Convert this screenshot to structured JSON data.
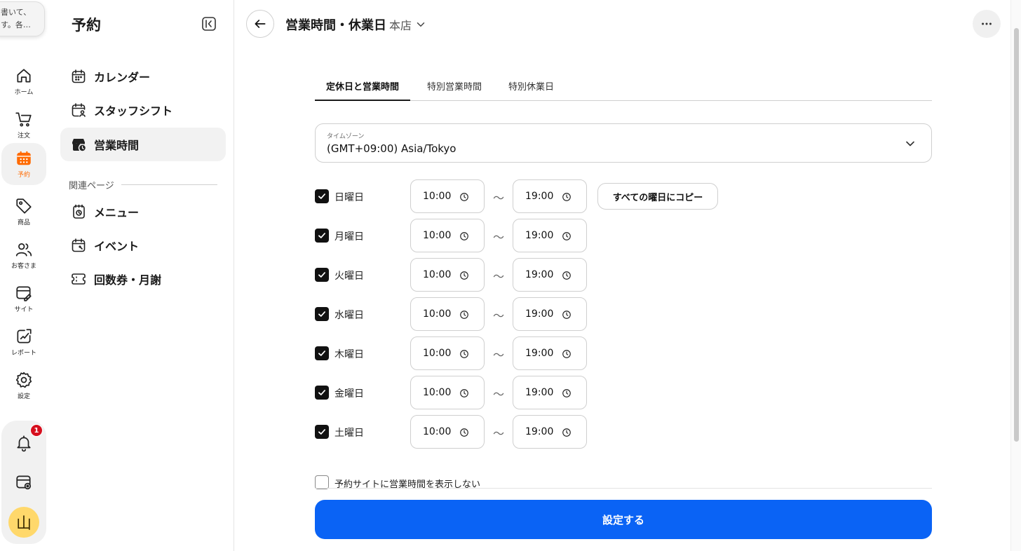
{
  "rail": {
    "tooltip_text": "書いて、\nす。各…",
    "items": [
      {
        "label": "ホーム",
        "icon": "home-icon"
      },
      {
        "label": "注文",
        "icon": "cart-icon"
      },
      {
        "label": "予約",
        "icon": "calendar-icon",
        "active": true
      },
      {
        "label": "商品",
        "icon": "tag-icon"
      },
      {
        "label": "お客さま",
        "icon": "customers-icon"
      },
      {
        "label": "サイト",
        "icon": "site-icon"
      },
      {
        "label": "レポート",
        "icon": "report-icon"
      },
      {
        "label": "設定",
        "icon": "gear-icon"
      }
    ],
    "notification_count": "1",
    "avatar_initial": "山",
    "accent_color": "#ff6a00"
  },
  "sidebar": {
    "title": "予約",
    "items": [
      {
        "label": "カレンダー",
        "icon": "calendar-icon"
      },
      {
        "label": "スタッフシフト",
        "icon": "staff-shift-icon"
      },
      {
        "label": "営業時間",
        "icon": "business-hours-icon",
        "active": true
      }
    ],
    "related_heading": "関連ページ",
    "related_items": [
      {
        "label": "メニュー",
        "icon": "menu-icon"
      },
      {
        "label": "イベント",
        "icon": "event-icon"
      },
      {
        "label": "回数券・月謝",
        "icon": "ticket-icon"
      }
    ]
  },
  "header": {
    "title": "営業時間・休業日",
    "store": "本店"
  },
  "tabs": [
    {
      "label": "定休日と営業時間",
      "active": true
    },
    {
      "label": "特別営業時間"
    },
    {
      "label": "特別休業日"
    }
  ],
  "timezone": {
    "label": "タイムゾーン",
    "value": "(GMT+09:00) Asia/Tokyo"
  },
  "days": [
    {
      "label": "日曜日",
      "checked": true,
      "start": "10:00",
      "end": "19:00"
    },
    {
      "label": "月曜日",
      "checked": true,
      "start": "10:00",
      "end": "19:00"
    },
    {
      "label": "火曜日",
      "checked": true,
      "start": "10:00",
      "end": "19:00"
    },
    {
      "label": "水曜日",
      "checked": true,
      "start": "10:00",
      "end": "19:00"
    },
    {
      "label": "木曜日",
      "checked": true,
      "start": "10:00",
      "end": "19:00"
    },
    {
      "label": "金曜日",
      "checked": true,
      "start": "10:00",
      "end": "19:00"
    },
    {
      "label": "土曜日",
      "checked": true,
      "start": "10:00",
      "end": "19:00"
    }
  ],
  "range_separator": "〜",
  "copy_button": "すべての曜日にコピー",
  "hide_hours_label": "予約サイトに営業時間を表示しない",
  "hide_hours_checked": false,
  "submit_button": "設定する",
  "submit_color": "#0a63f5"
}
